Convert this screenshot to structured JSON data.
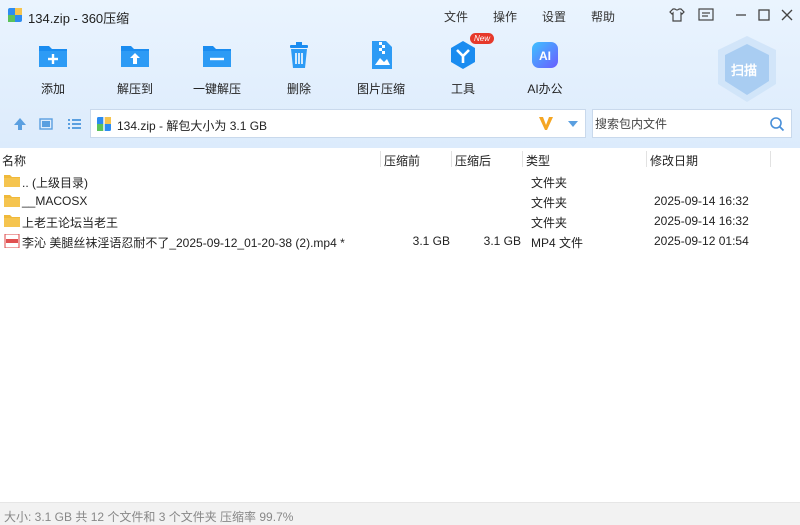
{
  "window": {
    "title": "134.zip - 360压缩"
  },
  "menu": {
    "file": "文件",
    "operate": "操作",
    "settings": "设置",
    "help": "帮助"
  },
  "toolbar": {
    "add": "添加",
    "extract_to": "解压到",
    "one_click_extract": "一键解压",
    "delete": "删除",
    "image_compress": "图片压缩",
    "tools": "工具",
    "tools_badge": "New",
    "ai_office": "AI办公",
    "ai_icon_text": "AI",
    "scan": "扫描"
  },
  "address": {
    "text": "134.zip - 解包大小为 3.1 GB"
  },
  "search": {
    "placeholder": "搜索包内文件"
  },
  "columns": {
    "name": "名称",
    "compressed": "压缩前",
    "packed": "压缩后",
    "type": "类型",
    "modified": "修改日期"
  },
  "files": [
    {
      "name": ".. (上级目录)",
      "before": "",
      "after": "",
      "type": "文件夹",
      "date": ""
    },
    {
      "name": "__MACOSX",
      "before": "",
      "after": "",
      "type": "文件夹",
      "date": "2025-09-14 16:32"
    },
    {
      "name": "上老王论坛当老王",
      "before": "",
      "after": "",
      "type": "文件夹",
      "date": "2025-09-14 16:32"
    },
    {
      "name": "李沁 美腿丝袜淫语忍耐不了_2025-09-12_01-20-38 (2).mp4 *",
      "before": "3.1 GB",
      "after": "3.1 GB",
      "type": "MP4 文件",
      "date": "2025-09-12 01:54"
    }
  ],
  "status": {
    "text": "大小: 3.1 GB 共 12 个文件和 3 个文件夹 压缩率 99.7%"
  },
  "colors": {
    "accent": "#1a8cf0",
    "toolbar_bg": "#e3effd",
    "folder": "#f5c44f"
  }
}
